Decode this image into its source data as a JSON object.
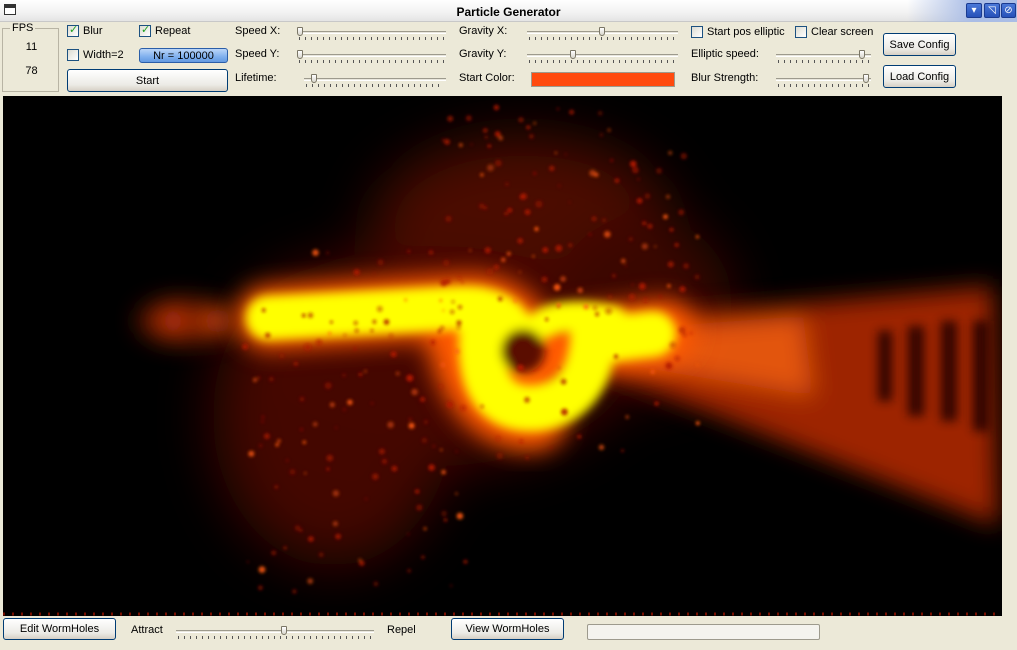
{
  "window": {
    "title": "Particle Generator"
  },
  "fps": {
    "label": "FPS",
    "values": [
      "11",
      "78"
    ]
  },
  "controls": {
    "blur": {
      "label": "Blur",
      "checked": true
    },
    "repeat": {
      "label": "Repeat",
      "checked": true
    },
    "width2": {
      "label": "Width=2",
      "checked": false
    },
    "count_button": "Nr = 100000",
    "start_button": "Start",
    "speed_x": "Speed X:",
    "speed_y": "Speed Y:",
    "lifetime": "Lifetime:",
    "gravity_x": "Gravity X:",
    "gravity_y": "Gravity Y:",
    "start_color": {
      "label": "Start Color:",
      "color": "#ff4a0e"
    },
    "start_pos_elliptic": {
      "label": "Start pos elliptic",
      "checked": false
    },
    "clear_screen": {
      "label": "Clear screen",
      "checked": false
    },
    "elliptic_speed": "Elliptic speed:",
    "blur_strength": "Blur Strength:",
    "save_config": "Save Config",
    "load_config": "Load Config"
  },
  "sliders": {
    "speed_x": 0.0,
    "speed_y": 0.0,
    "lifetime": 0.05,
    "gravity_x": 0.5,
    "gravity_y": 0.3,
    "elliptic_speed": 0.95,
    "blur_strength": 1.0,
    "attract_repel": 0.55
  },
  "bottom": {
    "edit_wormholes": "Edit WormHoles",
    "attract": "Attract",
    "repel": "Repel",
    "view_wormholes": "View WormHoles"
  },
  "colors": {
    "accent": "#ffff00",
    "glow": "#ff4a0e",
    "background": "#000000"
  }
}
